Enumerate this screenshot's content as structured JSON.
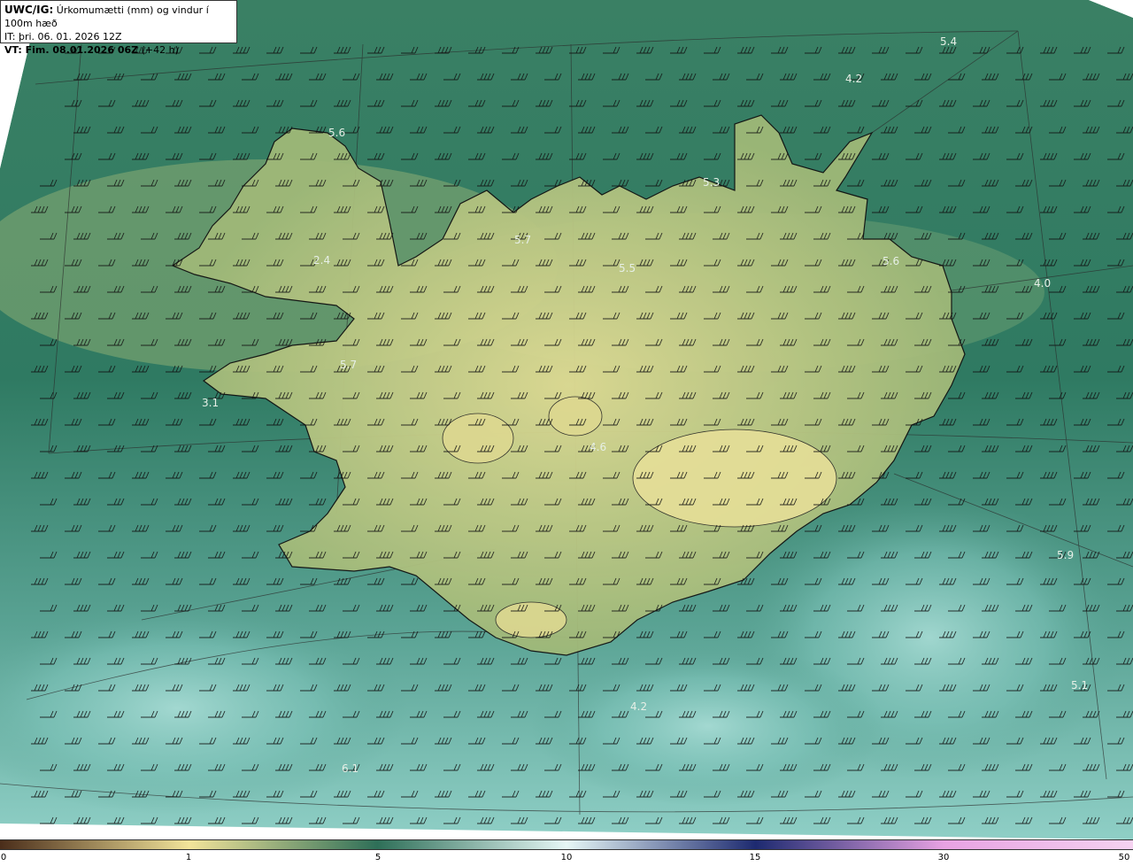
{
  "header": {
    "title_prefix": "UWC/IG:",
    "title_text": " Úrkomumætti (mm) og vindur í 100m hæð",
    "issue_time": "IT: þri. 06. 01. 2026 12Z",
    "valid_prefix": "VT: Fim. 08.01.2026 06Z",
    "valid_suffix": " (+42 h)"
  },
  "legend": {
    "ticks": [
      "0",
      "1",
      "5",
      "10",
      "15",
      "30",
      "50"
    ],
    "colors": {
      "c0": "#4a2d1a",
      "c1": "#f2e49a",
      "c5": "#2e6f58",
      "c10": "#e6f7f6",
      "c15": "#1d2a70",
      "c30": "#e7a2e2",
      "c50": "#f5d2f0"
    }
  },
  "map": {
    "sea_color": "#2f7a62",
    "land_color": "#c8cd85",
    "coast_color": "#111111",
    "value_labels": [
      {
        "text": "5.4",
        "dark": false
      },
      {
        "text": "4.2",
        "dark": false
      },
      {
        "text": "5.6",
        "dark": false
      },
      {
        "text": "5.3",
        "dark": false
      },
      {
        "text": "5.7",
        "dark": false
      },
      {
        "text": "5.5",
        "dark": false
      },
      {
        "text": "5.6",
        "dark": false
      },
      {
        "text": "2.4",
        "dark": false
      },
      {
        "text": "4.0",
        "dark": false
      },
      {
        "text": "5.7",
        "dark": false
      },
      {
        "text": "3.1",
        "dark": false
      },
      {
        "text": "4.6",
        "dark": false
      },
      {
        "text": "5.9",
        "dark": false
      },
      {
        "text": "5.1",
        "dark": false
      },
      {
        "text": "4.2",
        "dark": false
      },
      {
        "text": "6.1",
        "dark": false
      }
    ]
  }
}
